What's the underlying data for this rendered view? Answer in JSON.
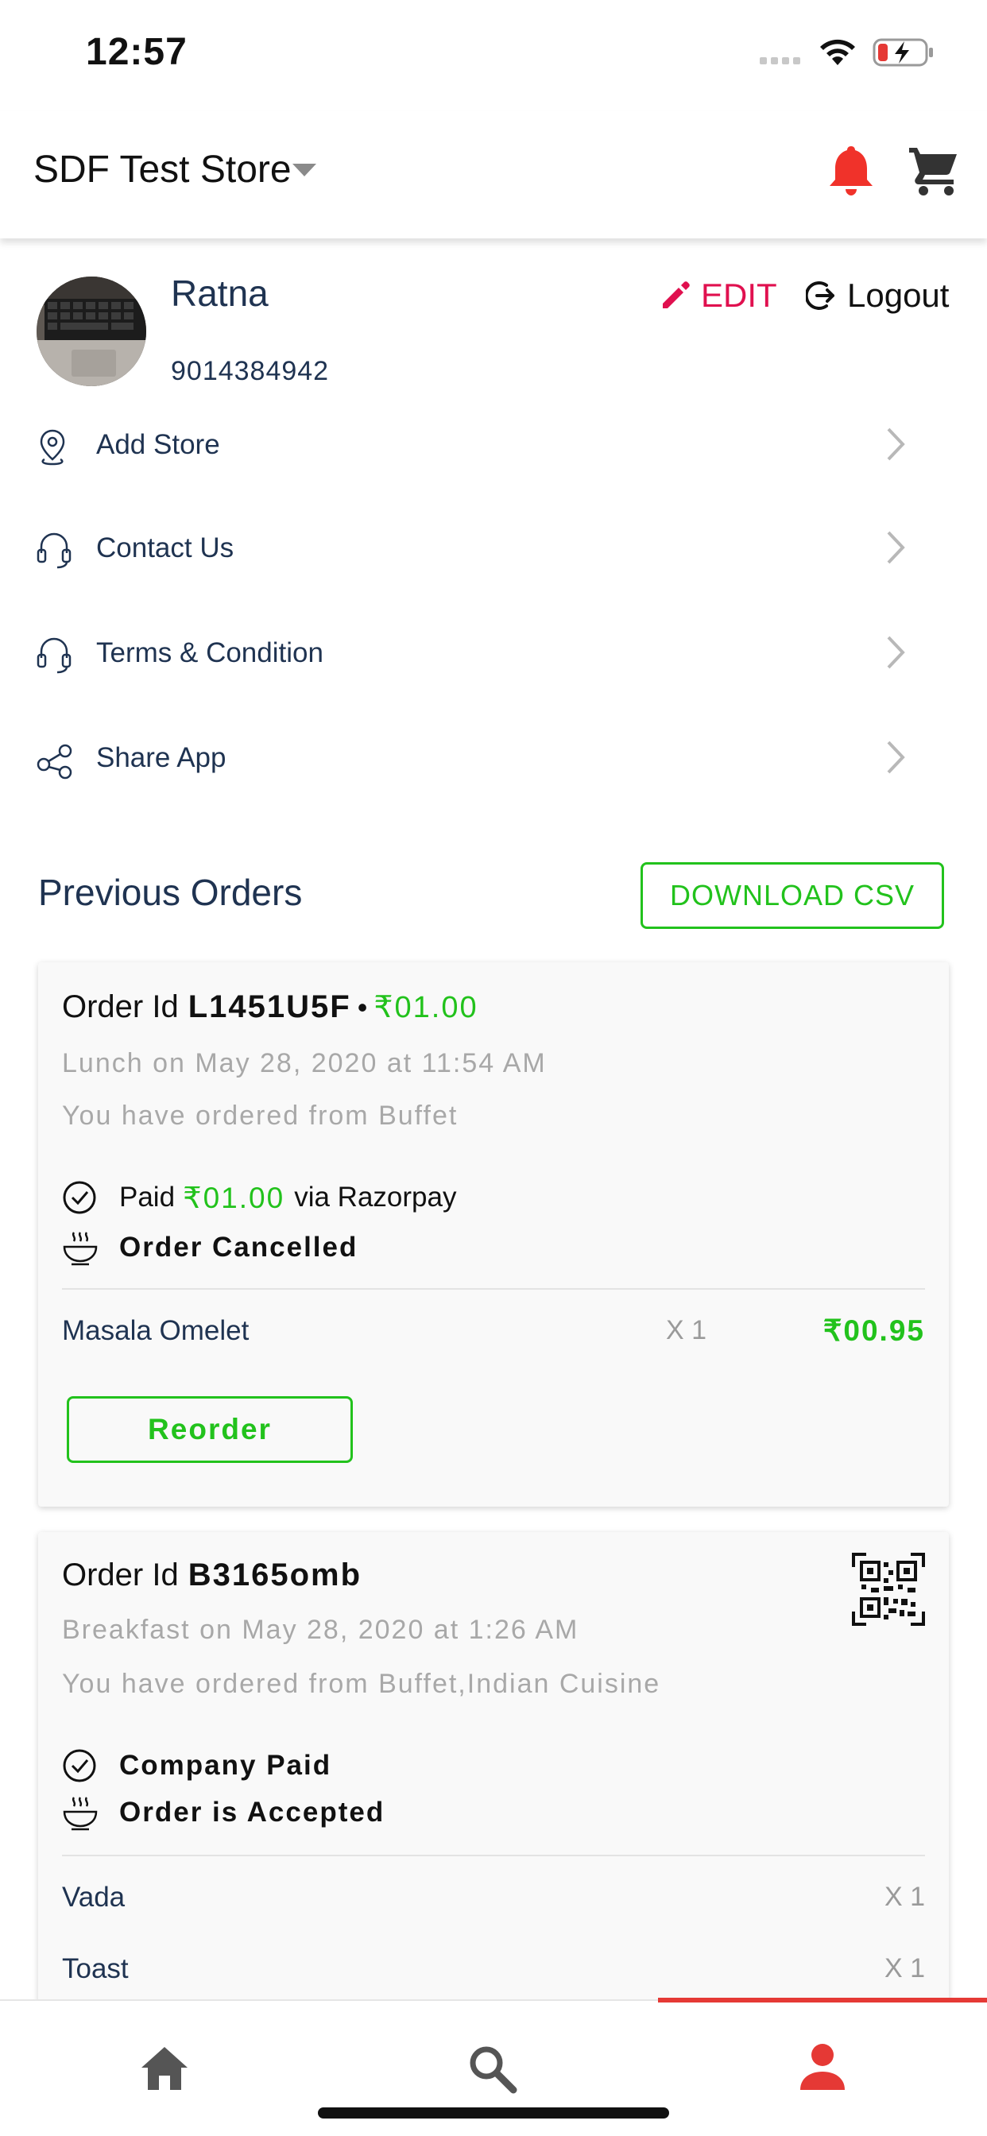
{
  "status_bar": {
    "time": "12:57",
    "icons": [
      "cellular-icon",
      "wifi-icon",
      "battery-charging-icon"
    ]
  },
  "header": {
    "store_name": "SDF Test Store",
    "icons": [
      "chevron-down-icon",
      "bell-icon",
      "cart-icon"
    ]
  },
  "profile": {
    "name": "Ratna",
    "phone": "9014384942",
    "edit_label": "EDIT",
    "logout_label": "Logout"
  },
  "menu": [
    {
      "label": "Add Store",
      "icon": "location-pin-icon"
    },
    {
      "label": "Contact Us",
      "icon": "headset-icon"
    },
    {
      "label": "Terms & Condition",
      "icon": "headset-icon"
    },
    {
      "label": "Share App",
      "icon": "share-icon"
    }
  ],
  "previous_orders": {
    "title": "Previous Orders",
    "download_label": "DOWNLOAD CSV",
    "orders": [
      {
        "order_prefix": "Order Id",
        "order_id": "L1451U5F",
        "dot": "•",
        "amount": "₹01.00",
        "meal_info": "Lunch on May 28, 2020 at 11:54 AM",
        "ordered_from": "You have ordered from Buffet",
        "payment_prefix": "Paid",
        "payment_amount": "₹01.00",
        "payment_suffix": "via Razorpay",
        "status": "Order Cancelled",
        "items": [
          {
            "name": "Masala Omelet",
            "qty": "X 1",
            "price": "₹00.95"
          }
        ],
        "reorder_label": "Reorder"
      },
      {
        "order_prefix": "Order Id",
        "order_id": "B3165omb",
        "meal_info": "Breakfast on May 28, 2020 at 1:26 AM",
        "ordered_from": "You have ordered from Buffet,Indian Cuisine",
        "payment_text": "Company Paid",
        "status": "Order is Accepted",
        "items": [
          {
            "name": "Vada",
            "qty": "X 1"
          },
          {
            "name": "Toast",
            "qty": "X 1"
          }
        ]
      }
    ]
  },
  "bottom_nav": {
    "items": [
      "home-icon",
      "search-icon",
      "profile-icon"
    ],
    "active": "profile-icon",
    "colors": {
      "active": "#e53935",
      "inactive": "#555555"
    }
  },
  "colors": {
    "accent_green": "#22c21c",
    "edit_red": "#e0104f",
    "text_navy": "#1f3351"
  }
}
